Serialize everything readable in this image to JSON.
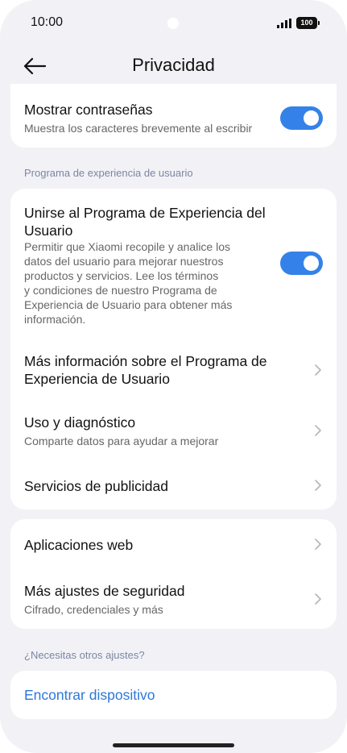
{
  "status_bar": {
    "time": "10:00",
    "battery": "100",
    "icons": [
      "signal-icon",
      "battery-icon"
    ]
  },
  "header": {
    "title": "Privacidad",
    "back_icon": "arrow-left-icon"
  },
  "card_top": {
    "show_passwords": {
      "title": "Mostrar contraseñas",
      "subtitle": "Muestra los caracteres brevemente al escribir",
      "enabled": true
    }
  },
  "section_experience": {
    "label": "Programa de experiencia de usuario",
    "join": {
      "title_line1": "Unirse al Programa de Experiencia del",
      "title_line2": "Usuario",
      "desc_lines": [
        "Permitir que Xiaomi recopile y analice los",
        "datos del usuario para mejorar nuestros",
        "productos y servicios. Lee los términos",
        "y condiciones de nuestro Programa de",
        "Experiencia de Usuario para obtener más",
        "información."
      ],
      "enabled": true
    },
    "more_info": {
      "title_line1": "Más información sobre el Programa de",
      "title_line2": "Experiencia de Usuario"
    },
    "usage": {
      "title": "Uso y diagnóstico",
      "subtitle": "Comparte datos para ayudar a mejorar"
    },
    "ads": {
      "title": "Servicios de publicidad"
    }
  },
  "card_web": {
    "web_apps": {
      "title": "Aplicaciones web"
    },
    "more_security": {
      "title": "Más ajustes de seguridad",
      "subtitle": "Cifrado, credenciales y más"
    }
  },
  "section_other": {
    "label": "¿Necesitas otros ajustes?",
    "find_device": "Encontrar dispositivo"
  },
  "colors": {
    "accent": "#3482e8",
    "link": "#2c78d8",
    "background": "#f2f2f6",
    "card": "#ffffff",
    "section_label": "#7b86a4"
  }
}
